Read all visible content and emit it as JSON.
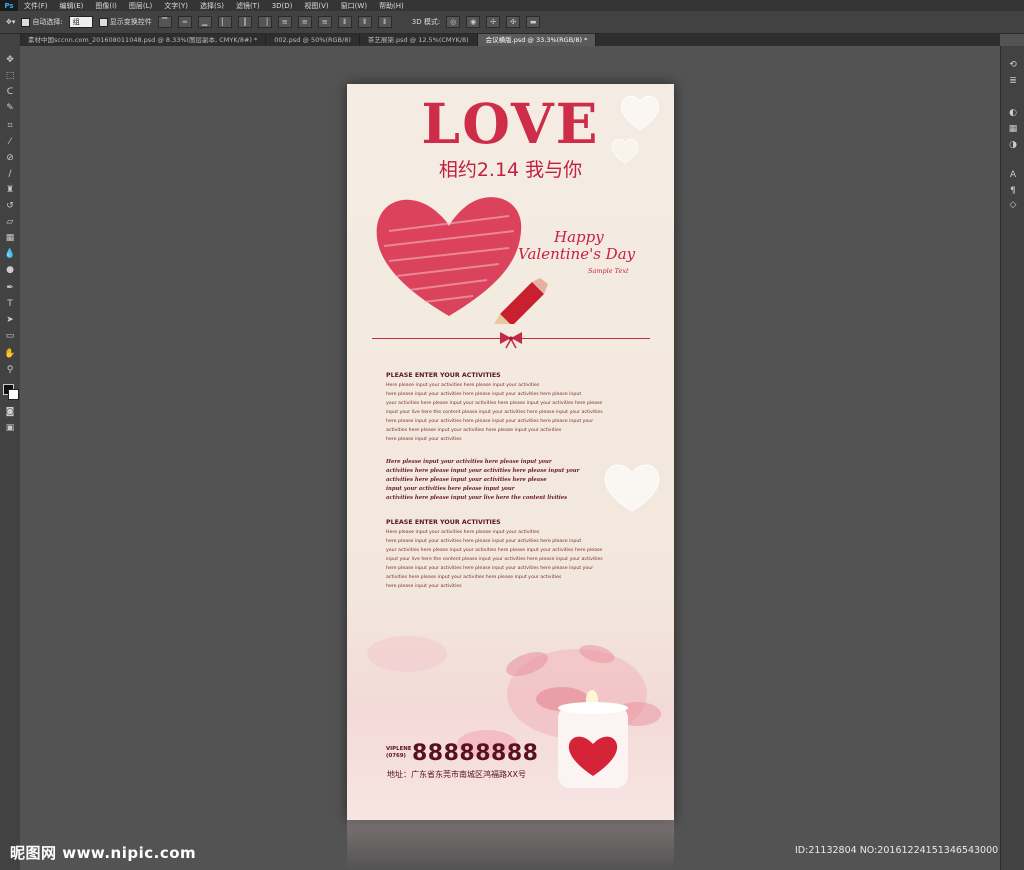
{
  "app": {
    "logo": "Ps"
  },
  "menu": [
    "文件(F)",
    "编辑(E)",
    "图像(I)",
    "图层(L)",
    "文字(Y)",
    "选择(S)",
    "滤镜(T)",
    "3D(D)",
    "视图(V)",
    "窗口(W)",
    "帮助(H)"
  ],
  "options_bar": {
    "auto_select_label": "自动选择:",
    "auto_select_value": "组",
    "show_transform_label": "显示变换控件",
    "mode_label": "3D 模式:"
  },
  "tabs": [
    {
      "label": "素材中国sccnn.com_201608011048.psd @ 8.33%(图层副本, CMYK/8#) *",
      "active": false
    },
    {
      "label": "002.psd @ 50%(RGB/8)",
      "active": false
    },
    {
      "label": "茶艺展架.psd @ 12.5%(CMYK/8)",
      "active": false
    },
    {
      "label": "会议横版.psd @ 33.3%(RGB/8) *",
      "active": true
    }
  ],
  "icons": [
    "move-icon",
    "marquee-icon",
    "lasso-icon",
    "quick-select-icon",
    "crop-icon",
    "eyedropper-icon",
    "healing-brush-icon",
    "brush-icon",
    "clone-stamp-icon",
    "history-brush-icon",
    "eraser-icon",
    "gradient-icon",
    "blur-icon",
    "dodge-icon",
    "pen-icon",
    "type-icon",
    "path-select-icon",
    "rectangle-icon",
    "hand-icon",
    "zoom-icon"
  ],
  "colors": {
    "accent": "#cf2c4a",
    "dark_text": "#5a1020",
    "canvas_bg": "#f4ece3",
    "workspace": "#535353"
  },
  "poster": {
    "love": "LOVE",
    "subtitle": "相约2.14 我与你",
    "happy": "Happy",
    "valentines": "Valentine's Day",
    "sample": "Sample Text",
    "section1_title": "PLEASE ENTER YOUR ACTIVITIES",
    "section1_lines": [
      "Here please input your activities here please input your activities",
      "here please input your activities here please input your activities here please input",
      "your activities here please input your activities here please input your activities here please",
      "input your live here the content please input your activities here please input your activities",
      "here please input your activities here please input your activities here please input your",
      "activities here please input your activities here please input your activities",
      "here please input your activities"
    ],
    "italic_lines": [
      "Here please input your activities here please input your",
      "activities here please input your activities here please input your",
      "activities here please input your activities here please",
      "input your activities here please input your",
      "activities here please input your live here the content livities"
    ],
    "section2_title": "PLEASE ENTER YOUR ACTIVITIES",
    "section2_lines": [
      "Here please input your activities here please input your activities",
      "here please input your activities here please input your activities here please input",
      "your activities here please input your activities here please input your activities here please",
      "input your live here the content please input your activities here please input your activities",
      "here please input your activities here please input your activities here please input your",
      "activities here please input your activities here please input your activities",
      "here please input your activities"
    ],
    "vip_label": "VIPLENE",
    "area_code": "(0769)",
    "phone": "88888888",
    "address": "地址：广东省东莞市南城区鸿福路XX号"
  },
  "watermark": "昵图网 www.nipic.com",
  "image_id": "ID:21132804 NO:20161224151346543000"
}
